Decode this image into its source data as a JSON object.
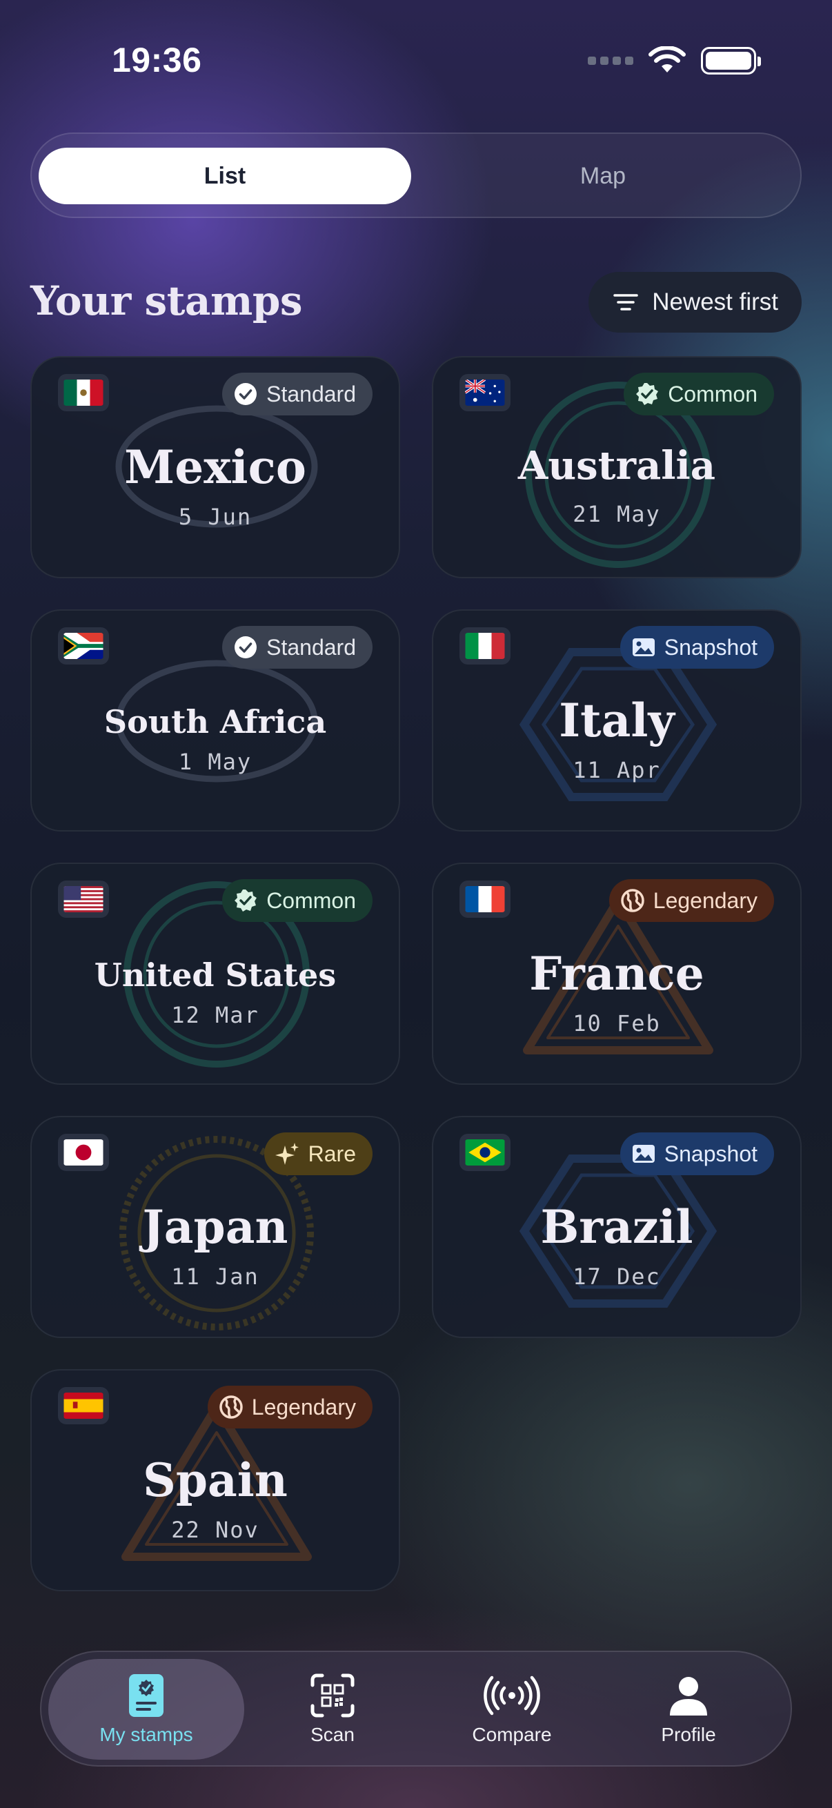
{
  "status_bar": {
    "time": "19:36"
  },
  "segments": [
    {
      "label": "List",
      "selected": true
    },
    {
      "label": "Map",
      "selected": false
    }
  ],
  "header": {
    "title": "Your stamps",
    "sort_label": "Newest first"
  },
  "stamps": [
    {
      "name": "Mexico",
      "date": "5 Jun",
      "badge": "Standard",
      "flag": "mexico-flag-icon"
    },
    {
      "name": "Australia",
      "date": "21 May",
      "badge": "Common",
      "flag": "australia-flag-icon"
    },
    {
      "name": "South Africa",
      "date": "1 May",
      "badge": "Standard",
      "flag": "south-africa-flag-icon"
    },
    {
      "name": "Italy",
      "date": "11 Apr",
      "badge": "Snapshot",
      "flag": "italy-flag-icon"
    },
    {
      "name": "United States",
      "date": "12 Mar",
      "badge": "Common",
      "flag": "usa-flag-icon"
    },
    {
      "name": "France",
      "date": "10 Feb",
      "badge": "Legendary",
      "flag": "france-flag-icon"
    },
    {
      "name": "Japan",
      "date": "11 Jan",
      "badge": "Rare",
      "flag": "japan-flag-icon"
    },
    {
      "name": "Brazil",
      "date": "17 Dec",
      "badge": "Snapshot",
      "flag": "brazil-flag-icon"
    },
    {
      "name": "Spain",
      "date": "22 Nov",
      "badge": "Legendary",
      "flag": "spain-flag-icon"
    }
  ],
  "nav": [
    {
      "label": "My stamps",
      "icon": "stamp-card-icon",
      "active": true
    },
    {
      "label": "Scan",
      "icon": "qr-scan-icon",
      "active": false
    },
    {
      "label": "Compare",
      "icon": "broadcast-icon",
      "active": false
    },
    {
      "label": "Profile",
      "icon": "person-icon",
      "active": false
    }
  ],
  "colors": {
    "accent": "#79e0f0",
    "standard_badge": "#3a4150",
    "common_badge": "#183a30",
    "snapshot_badge": "#1d3a6a",
    "legendary_badge": "#4d2618",
    "rare_badge": "#4e3f17"
  }
}
